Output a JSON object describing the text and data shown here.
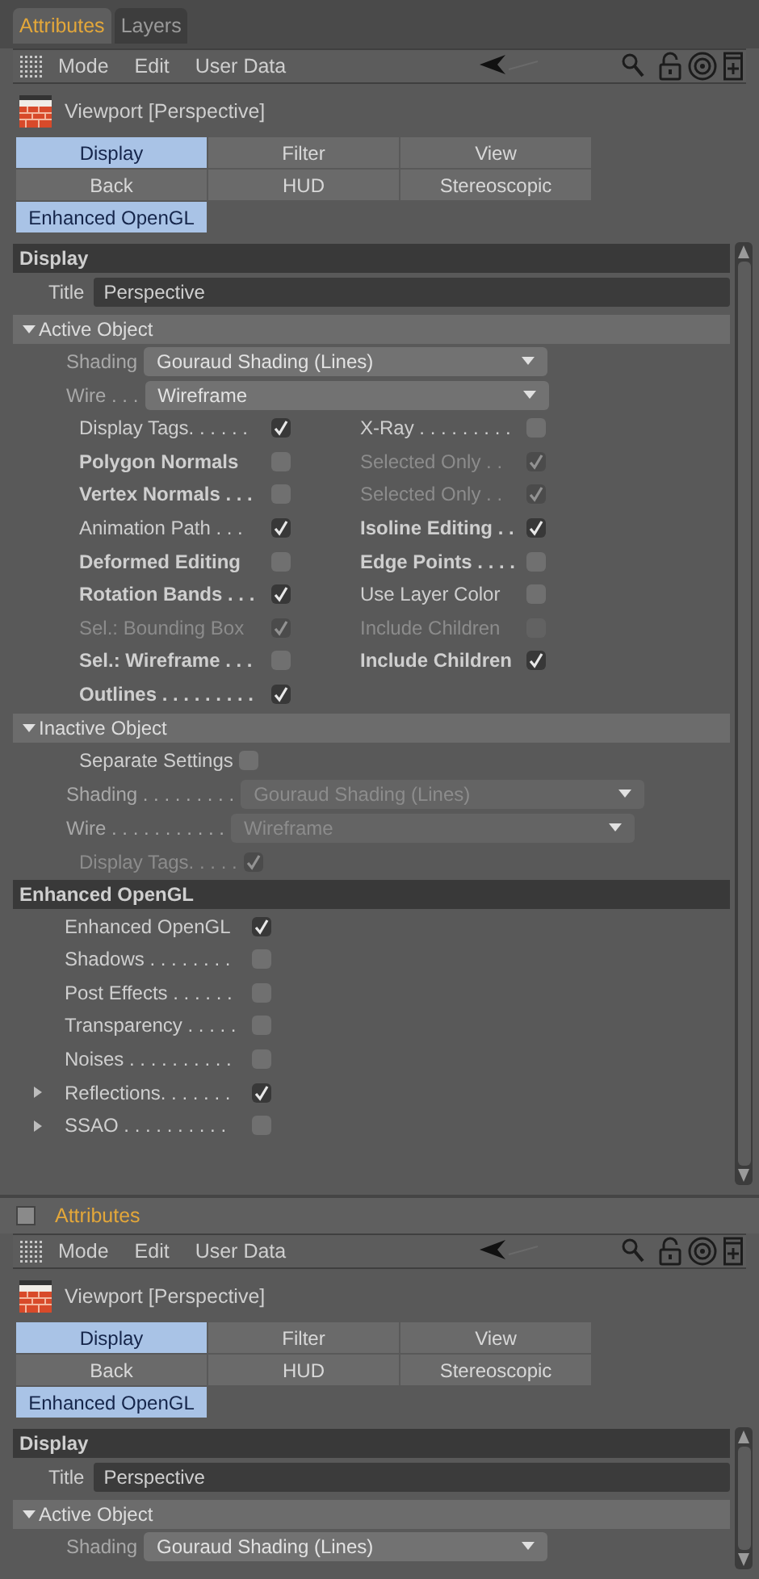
{
  "panels": [
    {
      "header": {
        "kind": "tabs",
        "tabs": [
          {
            "label": "Attributes",
            "selected": true
          },
          {
            "label": "Layers",
            "selected": false
          }
        ]
      },
      "menu": [
        "Mode",
        "Edit",
        "User Data"
      ],
      "object_title": "Viewport [Perspective]",
      "tab_buttons": [
        {
          "label": "Display",
          "selected": true
        },
        {
          "label": "Filter",
          "selected": false
        },
        {
          "label": "View",
          "selected": false
        },
        {
          "label": "Back",
          "selected": false
        },
        {
          "label": "HUD",
          "selected": false
        },
        {
          "label": "Stereoscopic",
          "selected": false
        },
        {
          "label": "Enhanced OpenGL",
          "selected": true
        }
      ],
      "rows": [
        {
          "kind": "section",
          "label": "Display"
        },
        {
          "kind": "text_field",
          "label": "Title",
          "value": "Perspective"
        },
        {
          "kind": "group",
          "label": "Active Object",
          "expanded": true
        },
        {
          "kind": "dropdown",
          "label": "Shading",
          "value": "Gouraud Shading (Lines)",
          "disabled": false
        },
        {
          "kind": "dropdown",
          "label": "Wire . . .",
          "value": "Wireframe",
          "disabled": false
        },
        {
          "kind": "check_pair",
          "cells": [
            {
              "label": "Display Tags. . . . . .",
              "checked": true,
              "bold": false,
              "disabled": false
            },
            {
              "label": "X-Ray . . . . . . . . .",
              "checked": false,
              "bold": false,
              "disabled": false
            }
          ]
        },
        {
          "kind": "check_pair",
          "cells": [
            {
              "label": "Polygon Normals",
              "checked": false,
              "bold": true,
              "disabled": false
            },
            {
              "label": "Selected Only . .",
              "checked": true,
              "bold": false,
              "disabled": true
            }
          ]
        },
        {
          "kind": "check_pair",
          "cells": [
            {
              "label": "Vertex Normals . . .",
              "checked": false,
              "bold": true,
              "disabled": false
            },
            {
              "label": "Selected Only . .",
              "checked": true,
              "bold": false,
              "disabled": true
            }
          ]
        },
        {
          "kind": "check_pair",
          "cells": [
            {
              "label": "Animation Path . . .",
              "checked": true,
              "bold": false,
              "disabled": false
            },
            {
              "label": "Isoline Editing . .",
              "checked": true,
              "bold": true,
              "disabled": false
            }
          ]
        },
        {
          "kind": "check_pair",
          "cells": [
            {
              "label": "Deformed Editing",
              "checked": false,
              "bold": true,
              "disabled": false
            },
            {
              "label": "Edge Points . . . .",
              "checked": false,
              "bold": true,
              "disabled": false
            }
          ]
        },
        {
          "kind": "check_pair",
          "cells": [
            {
              "label": "Rotation Bands . . .",
              "checked": true,
              "bold": true,
              "disabled": false
            },
            {
              "label": "Use Layer Color",
              "checked": false,
              "bold": false,
              "disabled": false
            }
          ]
        },
        {
          "kind": "check_pair",
          "cells": [
            {
              "label": "Sel.: Bounding Box",
              "checked": true,
              "bold": false,
              "disabled": true
            },
            {
              "label": "Include Children",
              "checked": false,
              "bold": false,
              "disabled": true
            }
          ]
        },
        {
          "kind": "check_pair",
          "cells": [
            {
              "label": "Sel.: Wireframe . . .",
              "checked": false,
              "bold": true,
              "disabled": false
            },
            {
              "label": "Include Children",
              "checked": true,
              "bold": true,
              "disabled": false
            }
          ]
        },
        {
          "kind": "check_pair",
          "cells": [
            {
              "label": "Outlines . . . . . . . . .",
              "checked": true,
              "bold": true,
              "disabled": false
            }
          ]
        },
        {
          "kind": "group",
          "label": "Inactive Object",
          "expanded": true
        },
        {
          "kind": "check",
          "label": "Separate Settings",
          "checked": false,
          "disabled": false
        },
        {
          "kind": "dropdown",
          "label": "Shading . . . . . . . . .",
          "value": "Gouraud Shading (Lines)",
          "disabled": true
        },
        {
          "kind": "dropdown",
          "label": "Wire . . . . . . . . . . .",
          "value": "Wireframe",
          "disabled": true
        },
        {
          "kind": "check",
          "label": "Display Tags. . . . .",
          "checked": true,
          "disabled": true
        },
        {
          "kind": "section",
          "label": "Enhanced OpenGL"
        },
        {
          "kind": "option",
          "label": "Enhanced OpenGL",
          "checked": true,
          "expandable": false
        },
        {
          "kind": "option",
          "label": "Shadows . . . . . . . .",
          "checked": false,
          "expandable": false
        },
        {
          "kind": "option",
          "label": "Post Effects . . . . . .",
          "checked": false,
          "expandable": false
        },
        {
          "kind": "option",
          "label": "Transparency . . . . .",
          "checked": false,
          "expandable": false
        },
        {
          "kind": "option",
          "label": "Noises . . . . . . . . . .",
          "checked": false,
          "expandable": false
        },
        {
          "kind": "option",
          "label": "Reflections. . . . . . .",
          "checked": true,
          "expandable": true
        },
        {
          "kind": "option",
          "label": "SSAO . . . . . . . . . .",
          "checked": false,
          "expandable": true
        }
      ]
    },
    {
      "header": {
        "kind": "title",
        "title": "Attributes"
      },
      "menu": [
        "Mode",
        "Edit",
        "User Data"
      ],
      "object_title": "Viewport [Perspective]",
      "tab_buttons": [
        {
          "label": "Display",
          "selected": true
        },
        {
          "label": "Filter",
          "selected": false
        },
        {
          "label": "View",
          "selected": false
        },
        {
          "label": "Back",
          "selected": false
        },
        {
          "label": "HUD",
          "selected": false
        },
        {
          "label": "Stereoscopic",
          "selected": false
        },
        {
          "label": "Enhanced OpenGL",
          "selected": true
        }
      ],
      "rows": [
        {
          "kind": "section",
          "label": "Display"
        },
        {
          "kind": "text_field",
          "label": "Title",
          "value": "Perspective"
        },
        {
          "kind": "group",
          "label": "Active Object",
          "expanded": true
        },
        {
          "kind": "dropdown",
          "label": "Shading",
          "value": "Gouraud Shading (Lines)",
          "disabled": false
        }
      ]
    }
  ]
}
